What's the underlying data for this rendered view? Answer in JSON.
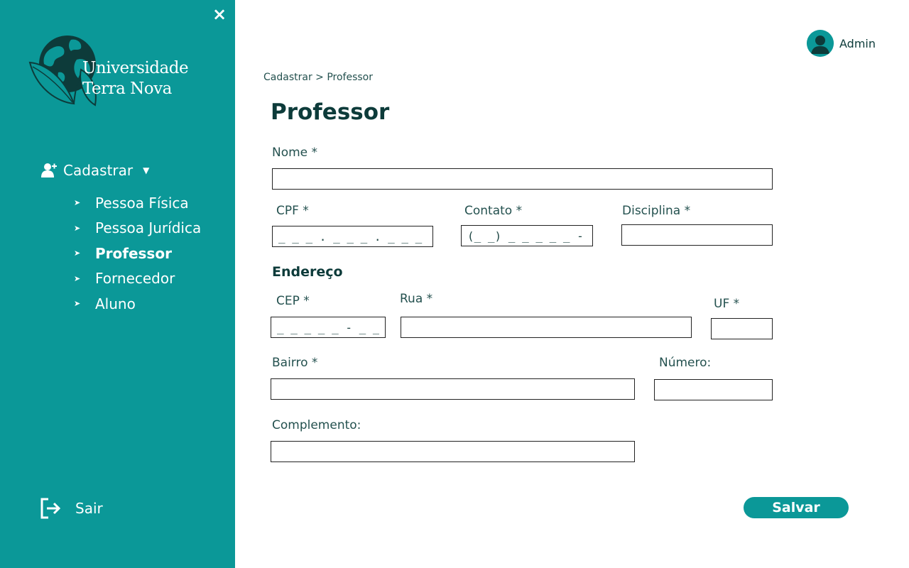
{
  "sidebar": {
    "close_icon": "×",
    "logo": {
      "line1": "Universidade",
      "line2": "Terra Nova"
    },
    "menu": {
      "label": "Cadastrar",
      "caret": "▼",
      "items": [
        {
          "label": "Pessoa Física",
          "active": false
        },
        {
          "label": "Pessoa Jurídica",
          "active": false
        },
        {
          "label": "Professor",
          "active": true
        },
        {
          "label": "Fornecedor",
          "active": false
        },
        {
          "label": "Aluno",
          "active": false
        }
      ],
      "arrow": "➤"
    },
    "logout_label": "Sair"
  },
  "header": {
    "user_name": "Admin"
  },
  "breadcrumb": "Cadastrar > Professor",
  "form": {
    "title": "Professor",
    "nome": {
      "label": "Nome *",
      "value": ""
    },
    "cpf": {
      "label": "CPF *",
      "placeholder": "_ _ _ . _ _ _ . _ _ _ - _ _"
    },
    "contato": {
      "label": "Contato *",
      "placeholder": "(_ _) _ _ _ _ _ - _ _ _ _"
    },
    "disciplina": {
      "label": "Disciplina *",
      "value": ""
    },
    "endereco_title": "Endereço",
    "cep": {
      "label": "CEP *",
      "placeholder": "_ _ _ _ _ - _ _ _"
    },
    "rua": {
      "label": "Rua *",
      "value": ""
    },
    "uf": {
      "label": "UF *",
      "value": ""
    },
    "bairro": {
      "label": "Bairro *",
      "value": ""
    },
    "numero": {
      "label": "Número:",
      "value": ""
    },
    "complemento": {
      "label": "Complemento:",
      "value": ""
    },
    "save_label": "Salvar"
  },
  "colors": {
    "primary": "#0b9898",
    "text_dark": "#0d3b3a"
  }
}
